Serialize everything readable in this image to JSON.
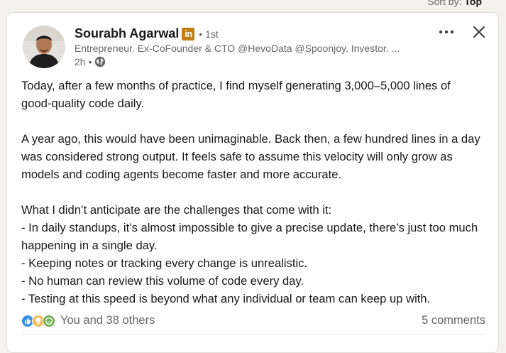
{
  "sort": {
    "label": "Sort by:",
    "value": "Top"
  },
  "post": {
    "author": {
      "name": "Sourabh Agarwal",
      "badge": "in",
      "degree": "• 1st",
      "headline": "Entrepreneur. Ex-CoFounder & CTO @HevoData @Spoonjoy. Investor. ...",
      "time": "2h",
      "separator": "•",
      "visibility_icon": "globe-icon"
    },
    "body": "Today, after a few months of practice, I find myself generating 3,000–5,000 lines of good-quality code daily.\n\nA year ago, this would have been unimaginable. Back then, a few hundred lines in a day was considered strong output. It feels safe to assume this velocity will only grow as models and coding agents become faster and more accurate.\n\nWhat I didn’t anticipate are the challenges that come with it:\n- In daily standups, it’s almost impossible to give a precise update, there’s just too much happening in a single day.\n- Keeping notes or tracking every change is unrealistic.\n- No human can review this volume of code every day.\n- Testing at this speed is beyond what any individual or team can keep up with.",
    "reactions": {
      "icons": [
        "like-icon",
        "insightful-icon",
        "support-icon"
      ],
      "text": "You and 38 others"
    },
    "comments": "5 comments"
  },
  "colors": {
    "like": "#378fe9",
    "insightful": "#f5bb5c",
    "support": "#6dae4f",
    "premium_badge": "#c37d16",
    "text_primary": "#191919",
    "text_secondary": "#666666"
  }
}
